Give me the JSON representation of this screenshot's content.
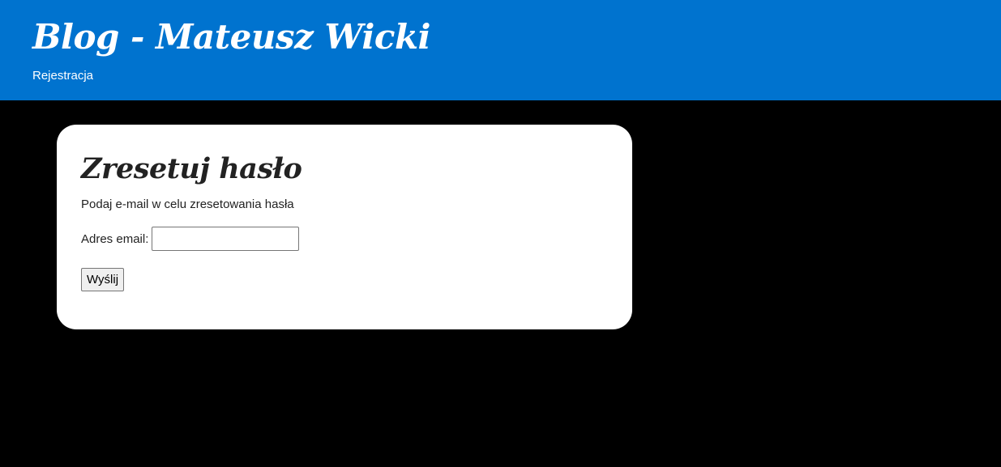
{
  "header": {
    "site_title": "Blog - Mateusz Wicki",
    "nav_link": "Rejestracja"
  },
  "reset_form": {
    "title": "Zresetuj hasło",
    "description": "Podaj e-mail w celu zresetowania hasła",
    "email_label": "Adres email:",
    "email_value": "",
    "submit_label": "Wyślij"
  },
  "colors": {
    "header_bg": "#0073cf",
    "page_bg": "#000000",
    "card_bg": "#ffffff"
  }
}
